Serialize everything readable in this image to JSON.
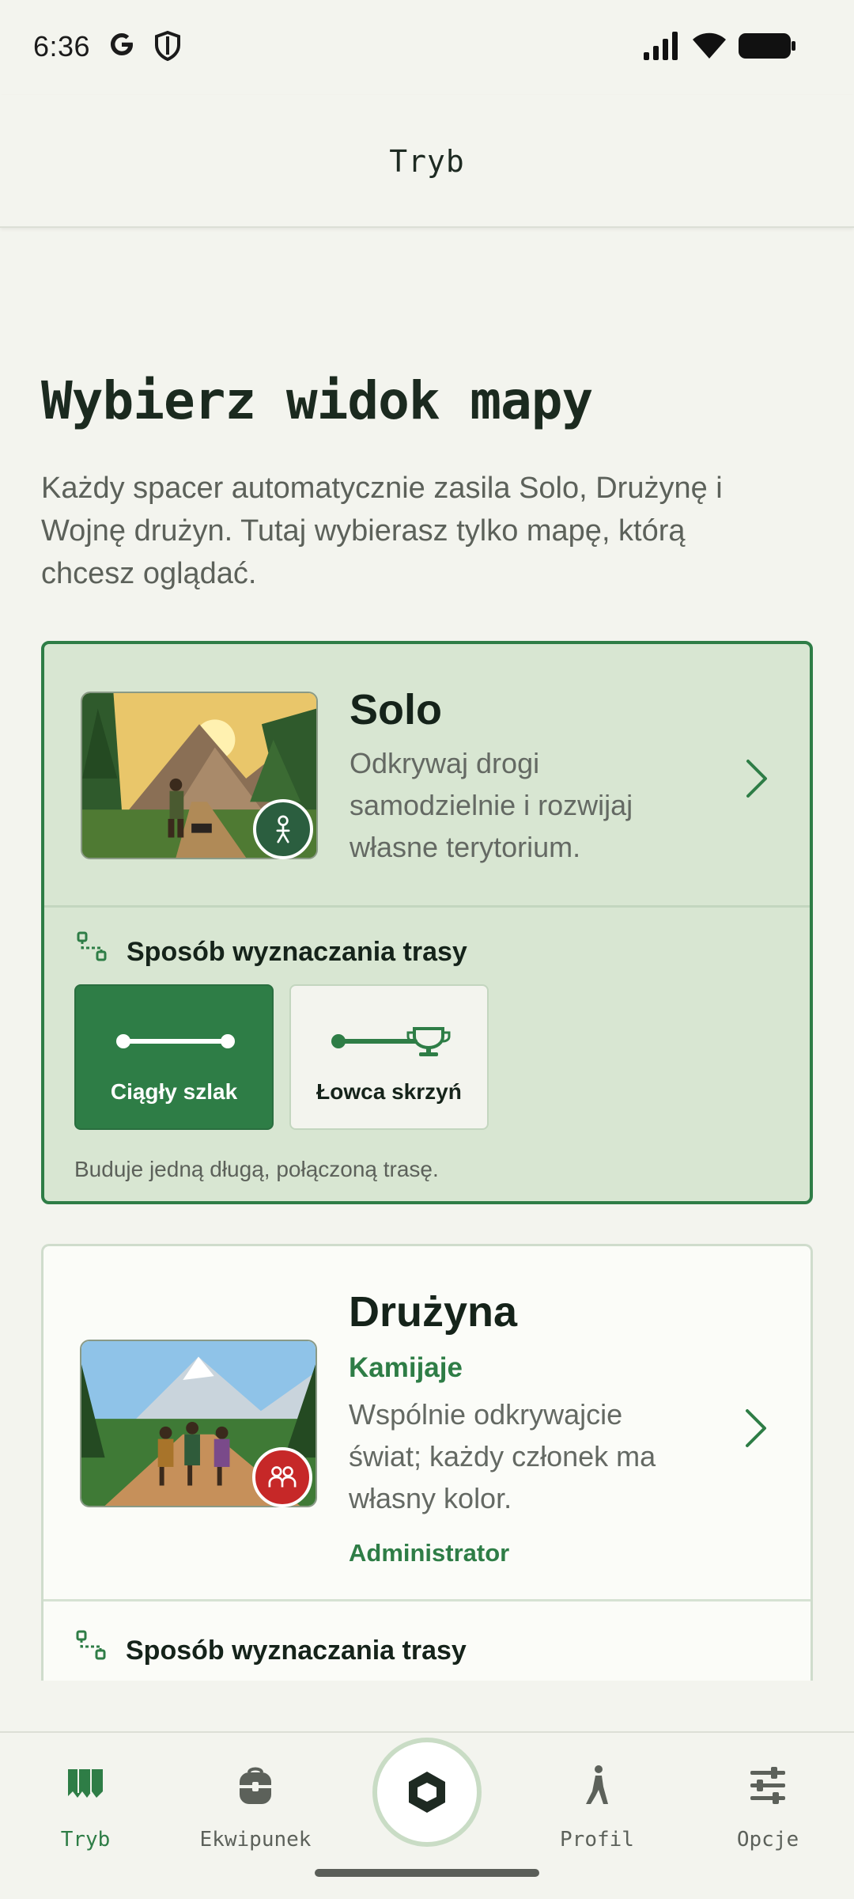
{
  "status_bar": {
    "time": "6:36",
    "icons": [
      "google-icon",
      "shield-icon",
      "signal-icon",
      "wifi-icon",
      "battery-icon"
    ]
  },
  "app_bar": {
    "title": "Tryb"
  },
  "main": {
    "heading": "Wybierz widok mapy",
    "intro": "Każdy spacer automatycznie zasila Solo, Drużynę i Wojnę drużyn. Tutaj wybierasz tylko mapę, którą chcesz oglądać.",
    "cards": [
      {
        "title": "Solo",
        "description": "Odkrywaj drogi samodzielnie i rozwijaj własne terytorium.",
        "selected": true,
        "route_label": "Sposób wyznaczania trasy",
        "route_options": [
          {
            "label": "Ciągły szlak",
            "selected": true
          },
          {
            "label": "Łowca skrzyń",
            "selected": false
          }
        ],
        "route_hint": "Buduje jedną długą, połączoną trasę."
      },
      {
        "title": "Drużyna",
        "subtitle": "Kamijaje",
        "description": "Wspólnie odkrywajcie świat; każdy członek ma własny kolor.",
        "role": "Administrator",
        "selected": false,
        "route_label": "Sposób wyznaczania trasy"
      }
    ]
  },
  "bottom_nav": {
    "items": [
      {
        "label": "Tryb",
        "icon": "map-icon",
        "active": true
      },
      {
        "label": "Ekwipunek",
        "icon": "backpack-icon",
        "active": false
      },
      {
        "label": "",
        "icon": "hexagon-icon",
        "active": false
      },
      {
        "label": "Profil",
        "icon": "walker-icon",
        "active": false
      },
      {
        "label": "Opcje",
        "icon": "sliders-icon",
        "active": false
      }
    ]
  },
  "colors": {
    "accent": "#2e7d46",
    "background": "#f3f4ee",
    "selected_card": "#d8e6d2",
    "team_badge": "#c62828"
  }
}
